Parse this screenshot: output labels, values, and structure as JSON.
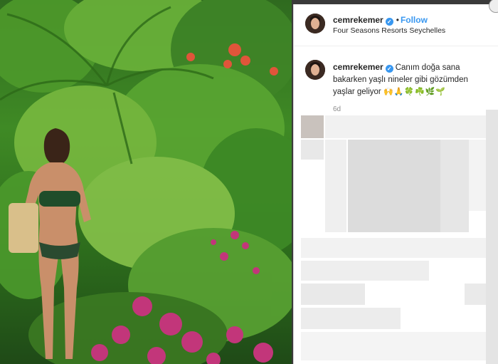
{
  "post": {
    "username": "cemrekemer",
    "follow_label": "Follow",
    "separator": "•",
    "location": "Four Seasons Resorts Seychelles"
  },
  "caption": {
    "username": "cemrekemer",
    "text": "Canım doğa sana bakarken yaşlı nineler gibi gözümden yaşlar geliyor",
    "emojis": "🙌🙏🍀☘️🌿🌱",
    "timestamp": "6d"
  },
  "colors": {
    "link": "#3897f0",
    "text": "#262626",
    "muted": "#8e8e8e"
  },
  "icons": {
    "verified": "verified-badge-icon",
    "more": "more-options-icon"
  }
}
